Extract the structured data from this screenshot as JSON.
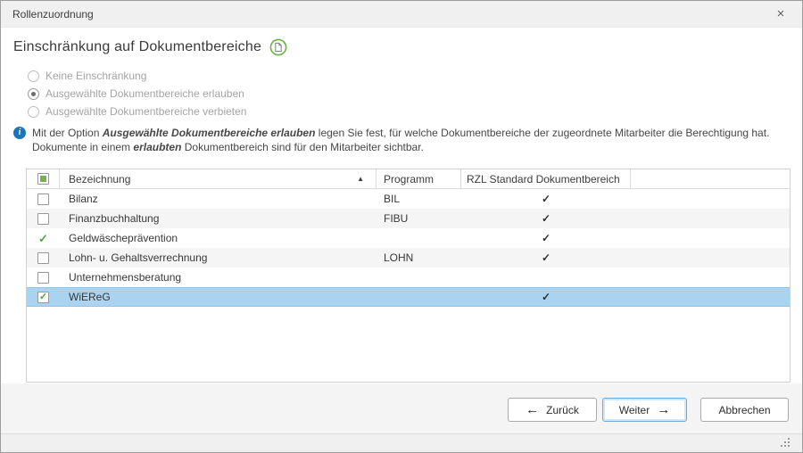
{
  "window": {
    "title": "Rollenzuordnung",
    "close_icon": "×"
  },
  "heading": {
    "text": "Einschränkung auf Dokumentbereiche"
  },
  "restriction_options": {
    "items": [
      {
        "label": "Keine Einschränkung",
        "selected": false
      },
      {
        "label": "Ausgewählte Dokumentbereiche erlauben",
        "selected": true
      },
      {
        "label": "Ausgewählte Dokumentbereiche verbieten",
        "selected": false
      }
    ],
    "disabled": true
  },
  "info_note": {
    "line1": {
      "prefix": "Mit der Option ",
      "emphasis": "Ausgewählte Dokumentbereiche erlauben",
      "suffix": " legen Sie fest, für welche Dokumentbereiche der zugeordnete Mitarbeiter die Berechtigung hat."
    },
    "line2": {
      "prefix": "Dokumente in einem ",
      "emphasis": "erlaubten",
      "suffix": " Dokumentbereich sind für den Mitarbeiter sichtbar."
    }
  },
  "table": {
    "columns": [
      {
        "label": "",
        "name": "selection"
      },
      {
        "label": "Bezeichnung",
        "sorted": "asc"
      },
      {
        "label": "Programm"
      },
      {
        "label": "RZL Standard Dokumentbereich"
      }
    ],
    "rows": [
      {
        "bezeichnung": "Bilanz",
        "programm": "BIL",
        "rzl_standard": true,
        "checkbox": "unchecked",
        "selected": false
      },
      {
        "bezeichnung": "Finanzbuchhaltung",
        "programm": "FIBU",
        "rzl_standard": true,
        "checkbox": "unchecked",
        "selected": false
      },
      {
        "bezeichnung": "Geldwäscheprävention",
        "programm": "",
        "rzl_standard": true,
        "checkbox": "green-check",
        "selected": false
      },
      {
        "bezeichnung": "Lohn- u. Gehaltsverrechnung",
        "programm": "LOHN",
        "rzl_standard": true,
        "checkbox": "unchecked",
        "selected": false
      },
      {
        "bezeichnung": "Unternehmensberatung",
        "programm": "",
        "rzl_standard": false,
        "checkbox": "unchecked",
        "selected": false
      },
      {
        "bezeichnung": "WiEReG",
        "programm": "",
        "rzl_standard": true,
        "checkbox": "checked",
        "selected": true
      }
    ]
  },
  "footer": {
    "back_icon": "←",
    "back_label": "Zurück",
    "next_label": "Weiter",
    "next_icon": "→",
    "cancel_label": "Abbrechen"
  },
  "icons": {
    "check": "✓",
    "sort_asc": "▲",
    "info": "i"
  },
  "colors": {
    "accent_green": "#5fae45",
    "selection_blue": "#a9d3ee",
    "info_blue": "#1c75bc",
    "focus_border_blue": "#71a9d4"
  }
}
